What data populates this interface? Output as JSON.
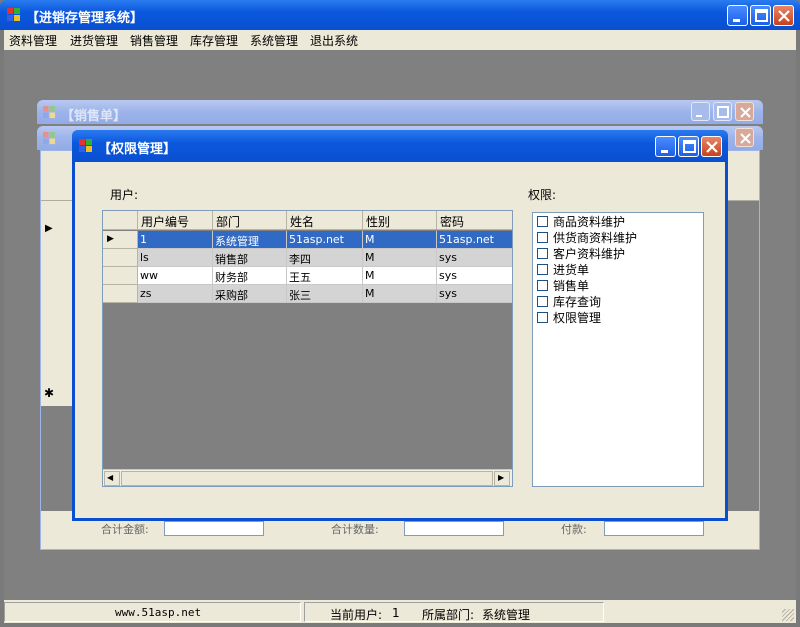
{
  "app": {
    "title": "【进销存管理系统】",
    "menu": [
      "资料管理",
      "进货管理",
      "销售管理",
      "库存管理",
      "系统管理",
      "退出系统"
    ]
  },
  "background_windows": {
    "sales_title": "【销售单】",
    "row_marker_arrow": "▶",
    "new_row_marker": "✱",
    "footer_labels": [
      "合计金额:",
      "合计数量:",
      "付款:"
    ]
  },
  "permission_window": {
    "title": "【权限管理】",
    "user_label": "用户:",
    "perm_label": "权限:",
    "grid": {
      "columns": [
        "用户编号",
        "部门",
        "姓名",
        "性别",
        "密码"
      ],
      "rows": [
        [
          "1",
          "系统管理",
          "51asp.net",
          "M",
          "51asp.net"
        ],
        [
          "ls",
          "销售部",
          "李四",
          "M",
          "sys"
        ],
        [
          "ww",
          "财务部",
          "王五",
          "M",
          "sys"
        ],
        [
          "zs",
          "采购部",
          "张三",
          "M",
          "sys"
        ]
      ],
      "selected_row": 0,
      "current_row_marker": "▶",
      "scroll_left": "◀",
      "scroll_right": "▶"
    },
    "permissions": [
      "商品资料维护",
      "供货商资料维护",
      "客户资料维护",
      "进货单",
      "销售单",
      "库存查询",
      "权限管理"
    ]
  },
  "statusbar": {
    "site": "www.51asp.net",
    "current_user_label": "当前用户:",
    "current_user": "1",
    "department_label": "所属部门:",
    "department": "系统管理"
  },
  "colors": {
    "title_active": "#0a52d8",
    "selection": "#316ac5",
    "face": "#ece9d8",
    "mdi_background": "#808080"
  }
}
